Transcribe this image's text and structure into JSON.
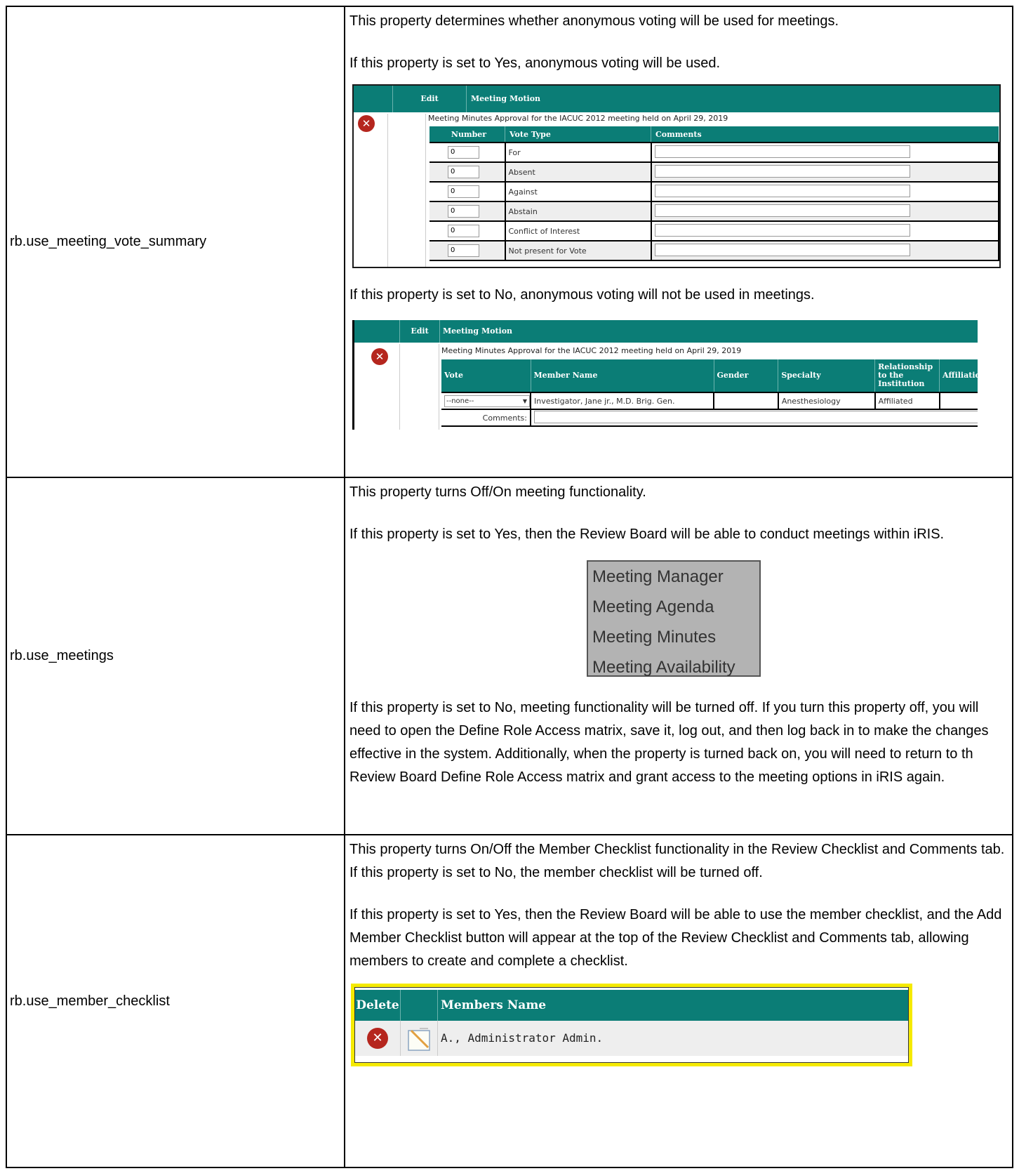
{
  "rows": [
    {
      "name": "rb.use_meeting_vote_summary",
      "p1": "This property determines whether anonymous voting will be used for meetings.",
      "p2": "If this property is set to Yes, anonymous voting will be used.",
      "p3": "If this property is set to No, anonymous voting will not be used in meetings."
    },
    {
      "name": "rb.use_meetings",
      "p1": "This property turns Off/On meeting functionality.",
      "p2": "If this property is set to Yes, then the Review Board will be able to conduct meetings within iRIS.",
      "p3": "If this property is set to No, meeting functionality will be turned off.  If you turn this property off, you will need to open the Define Role Access matrix, save it, log out, and then log back in to make the changes effective in the system.  Additionally, when the property is turned back on, you will need to return to th Review Board Define Role Access matrix and grant access to the meeting options in iRIS again."
    },
    {
      "name": "rb.use_member_checklist",
      "p1": "This property turns On/Off the Member Checklist functionality in the Review Checklist and Comments tab. If this property is set to No, the member checklist will be turned off.",
      "p2": "If this property is set to Yes, then the Review Board will be able to use the member checklist, and the Add Member Checklist button will appear at the top of the Review Checklist and Comments tab, allowing members to create and complete a checklist."
    }
  ],
  "vote_summary": {
    "header_edit": "Edit",
    "header_motion": "Meeting Motion",
    "motion_text": "Meeting Minutes Approval for the IACUC 2012 meeting held on April 29, 2019",
    "col_number": "Number",
    "col_vote_type": "Vote Type",
    "col_comments": "Comments",
    "votes": [
      {
        "number": "0",
        "type": "For"
      },
      {
        "number": "0",
        "type": "Absent"
      },
      {
        "number": "0",
        "type": "Against"
      },
      {
        "number": "0",
        "type": "Abstain"
      },
      {
        "number": "0",
        "type": "Conflict of Interest"
      },
      {
        "number": "0",
        "type": "Not present for Vote"
      }
    ]
  },
  "member_vote": {
    "header_edit": "Edit",
    "header_motion": "Meeting Motion",
    "motion_text": "Meeting Minutes Approval for the IACUC 2012 meeting held on April 29, 2019",
    "col_vote": "Vote",
    "col_member": "Member Name",
    "col_gender": "Gender",
    "col_specialty": "Specialty",
    "col_relationship": "Relationship to the Institution",
    "col_affiliation": "Affiliatio",
    "vote_value": "--none--",
    "member_name": "Investigator, Jane jr., M.D. Brig. Gen.",
    "gender": "",
    "specialty": "Anesthesiology",
    "relationship": "Affiliated",
    "comments_label": "Comments:"
  },
  "meeting_menu": [
    "Meeting Manager",
    "Meeting Agenda",
    "Meeting Minutes",
    "Meeting Availability"
  ],
  "member_checklist": {
    "col_delete": "Delete",
    "col_members_name": "Members Name",
    "member": "A., Administrator Admin."
  },
  "colors": {
    "teal_header": "#0b7d76",
    "delete_red": "#b5261e",
    "highlight_yellow": "#f5ea00",
    "menu_gray": "#b3b3b3"
  },
  "icons": [
    "delete-icon",
    "notepad-icon",
    "dropdown-arrow-icon"
  ]
}
